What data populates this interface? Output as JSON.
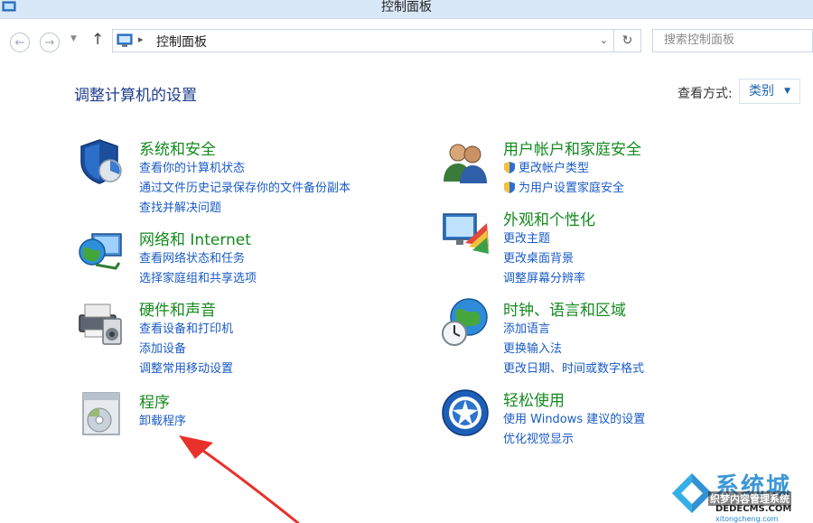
{
  "window": {
    "title": "控制面板"
  },
  "address": {
    "crumb": "控制面板",
    "search_placeholder": "搜索控制面板"
  },
  "header": {
    "title": "调整计算机的设置",
    "view_label": "查看方式:",
    "view_value": "类别"
  },
  "categories": [
    {
      "title": "系统和安全",
      "icon": "shield-icon",
      "links": [
        "查看你的计算机状态",
        "通过文件历史记录保存你的文件备份副本",
        "查找并解决问题"
      ]
    },
    {
      "title": "网络和 Internet",
      "icon": "network-globe-icon",
      "links": [
        "查看网络状态和任务",
        "选择家庭组和共享选项"
      ]
    },
    {
      "title": "硬件和声音",
      "icon": "printer-speaker-icon",
      "links": [
        "查看设备和打印机",
        "添加设备",
        "调整常用移动设置"
      ]
    },
    {
      "title": "程序",
      "icon": "programs-disc-icon",
      "links": [
        "卸载程序"
      ]
    },
    {
      "title": "用户帐户和家庭安全",
      "icon": "users-icon",
      "links": [
        "更改帐户类型",
        "为用户设置家庭安全"
      ]
    },
    {
      "title": "外观和个性化",
      "icon": "monitor-palette-icon",
      "links": [
        "更改主题",
        "更改桌面背景",
        "调整屏幕分辨率"
      ]
    },
    {
      "title": "时钟、语言和区域",
      "icon": "globe-clock-icon",
      "links": [
        "添加语言",
        "更换输入法",
        "更改日期、时间或数字格式"
      ]
    },
    {
      "title": "轻松使用",
      "icon": "ease-of-access-icon",
      "links": [
        "使用 Windows 建议的设置",
        "优化视觉显示"
      ]
    }
  ],
  "watermark": {
    "brand": "系统城",
    "line1": "织梦内容管理系统",
    "line2": "DEDECMS.COM",
    "line3": "xitongcheng.com"
  },
  "colors": {
    "category_title": "#148a1e",
    "link": "#1a5bc4",
    "page_title": "#1d3c8a",
    "annotation_arrow": "#e8312b"
  }
}
